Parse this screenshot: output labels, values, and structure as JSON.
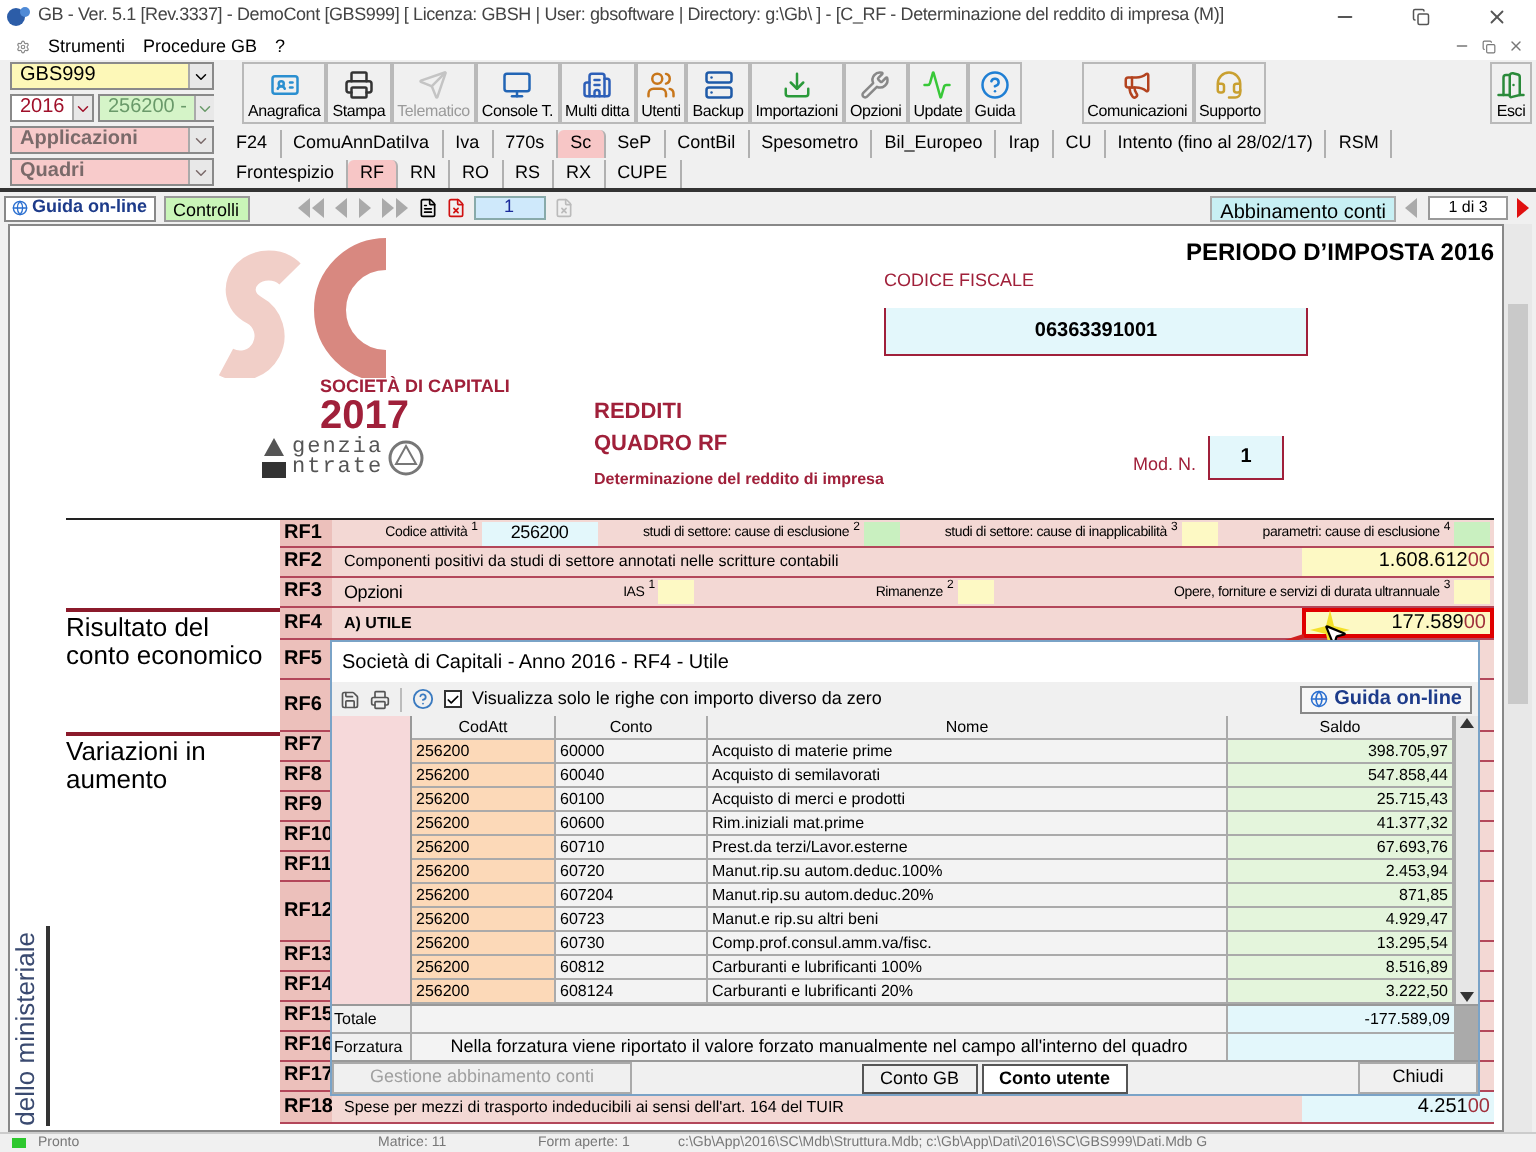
{
  "window": {
    "title": "GB - Ver. 5.1 [Rev.3337] -  DemoCont [GBS999]    [ Licenza: GBSH | User: gbsoftware | Directory: g:\\Gb\\ ] - [C_RF - Determinazione del reddito di impresa (M)]"
  },
  "menu": [
    "Strumenti",
    "Procedure GB",
    "?"
  ],
  "selectors": {
    "company": "GBS999",
    "year": "2016",
    "activity": "256200 -",
    "applications": "Applicazioni",
    "sections": "Quadri"
  },
  "toolbar": {
    "main": [
      {
        "label": "Anagrafica",
        "disabled": false
      },
      {
        "label": "Stampa",
        "disabled": false
      },
      {
        "label": "Telematico",
        "disabled": true
      },
      {
        "label": "Console T.",
        "disabled": false
      },
      {
        "label": "Multi ditta",
        "disabled": false
      },
      {
        "label": "Utenti",
        "disabled": false
      },
      {
        "label": "Backup",
        "disabled": false
      },
      {
        "label": "Importazioni",
        "disabled": false
      },
      {
        "label": "Opzioni",
        "disabled": false
      },
      {
        "label": "Update",
        "disabled": false
      },
      {
        "label": "Guida",
        "disabled": false
      }
    ],
    "support": [
      {
        "label": "Comunicazioni",
        "disabled": false
      },
      {
        "label": "Supporto",
        "disabled": false
      }
    ],
    "exit": {
      "label": "Esci",
      "disabled": false
    }
  },
  "app_tabs": [
    {
      "label": "F24",
      "selected": false
    },
    {
      "label": "ComuAnnDatiIva",
      "selected": false
    },
    {
      "label": "Iva",
      "selected": false
    },
    {
      "label": "770s",
      "selected": false
    },
    {
      "label": "Sc",
      "selected": true
    },
    {
      "label": "SeP",
      "selected": false
    },
    {
      "label": "ContBil",
      "selected": false
    },
    {
      "label": "Spesometro",
      "selected": false
    },
    {
      "label": "Bil_Europeo",
      "selected": false
    },
    {
      "label": "Irap",
      "selected": false
    },
    {
      "label": "CU",
      "selected": false
    },
    {
      "label": "Intento (fino al 28/02/17)",
      "selected": false
    },
    {
      "label": "RSM",
      "selected": false
    }
  ],
  "form_tabs": [
    {
      "label": "Frontespizio",
      "selected": false
    },
    {
      "label": "RF",
      "selected": true
    },
    {
      "label": "RN",
      "selected": false
    },
    {
      "label": "RO",
      "selected": false
    },
    {
      "label": "RS",
      "selected": false
    },
    {
      "label": "RX",
      "selected": false
    },
    {
      "label": "CUPE",
      "selected": false
    }
  ],
  "nav": {
    "help": "Guida on-line",
    "checks": "Controlli",
    "page": "1",
    "links": "Abbinamento conti",
    "page_of": "1 di 3"
  },
  "form": {
    "period": "PERIODO D’IMPOSTA 2016",
    "logo_type": "SOCIETÀ DI CAPITALI",
    "logo_year": "2017",
    "agency": [
      "genzia",
      "ntrate"
    ],
    "title": [
      "REDDITI",
      "QUADRO RF"
    ],
    "subtitle": "Determinazione del reddito di impresa",
    "tax_code_label": "CODICE FISCALE",
    "tax_code": "06363391001",
    "module_label": "Mod. N.",
    "module": "1",
    "side_label": "dello ministeriale"
  },
  "rows": [
    {
      "code": "RF1",
      "kind": "fields",
      "fields": [
        {
          "label": "Codice attività",
          "index": "1",
          "value": "256200",
          "color": "#e3f7fb"
        },
        {
          "label": "studi di settore: cause di esclusione",
          "index": "2",
          "color": "#c9f0c0"
        },
        {
          "label": "studi di settore: cause di inapplicabilità",
          "index": "3",
          "color": "#fdf9c4"
        },
        {
          "label": "parametri: cause di esclusione",
          "index": "4",
          "color": "#c9f0c0"
        }
      ]
    },
    {
      "code": "RF2",
      "kind": "amount",
      "label": "Componenti positivi da studi di settore annotati nelle scritture contabili",
      "value": "1.608.612",
      "cents": "00",
      "color": "#fdf9c4",
      "emphasis": false,
      "highlighted": false
    },
    {
      "code": "RF3",
      "kind": "fields",
      "label": "Opzioni",
      "fields": [
        {
          "label": "IAS",
          "index": "1",
          "color": "#fdf9c4"
        },
        {
          "label": "Rimanenze",
          "index": "2",
          "color": "#fdf9c4"
        },
        {
          "label": "Opere, forniture e servizi di durata ultrannuale",
          "index": "3",
          "color": "#fdf9c4"
        }
      ]
    },
    {
      "code": "RF4",
      "kind": "amount",
      "section": "Risultato del conto economico",
      "label": "A) UTILE",
      "value": "177.589",
      "cents": "00",
      "color": "#fdf9c4",
      "emphasis": true,
      "highlighted": true
    },
    {
      "code": "RF5",
      "kind": "empty"
    },
    {
      "code": "RF6",
      "kind": "empty"
    },
    {
      "code": "RF7",
      "kind": "empty",
      "section": "Variazioni in aumento"
    },
    {
      "code": "RF8",
      "kind": "empty"
    },
    {
      "code": "RF9",
      "kind": "empty"
    },
    {
      "code": "RF10",
      "kind": "empty"
    },
    {
      "code": "RF11",
      "kind": "empty"
    },
    {
      "code": "RF12",
      "kind": "empty"
    },
    {
      "code": "RF13",
      "kind": "empty"
    },
    {
      "code": "RF14",
      "kind": "empty"
    },
    {
      "code": "RF15",
      "kind": "empty"
    },
    {
      "code": "RF16",
      "kind": "empty"
    },
    {
      "code": "RF17",
      "kind": "empty"
    },
    {
      "code": "RF18",
      "kind": "amount",
      "label": "Spese per mezzi di trasporto indeducibili ai sensi dell'art. 164 del TUIR",
      "value": "4.251",
      "cents": "00",
      "color": "#e3f7fb",
      "emphasis": false,
      "highlighted": false
    }
  ],
  "popup": {
    "title": "Società di Capitali - Anno 2016 - RF4 - Utile",
    "filter": {
      "label": "Visualizza solo le righe con importo diverso da zero",
      "checked": true
    },
    "help": "Guida on-line",
    "columns": [
      "CodAtt",
      "Conto",
      "Nome",
      "Saldo"
    ],
    "rows": [
      [
        "256200",
        "60000",
        "Acquisto di materie prime",
        "398.705,97"
      ],
      [
        "256200",
        "60040",
        "Acquisto di semilavorati",
        "547.858,44"
      ],
      [
        "256200",
        "60100",
        "Acquisto di merci e prodotti",
        "25.715,43"
      ],
      [
        "256200",
        "60600",
        "Rim.iniziali mat.prime",
        "41.377,32"
      ],
      [
        "256200",
        "60710",
        "Prest.da terzi/Lavor.esterne",
        "67.693,76"
      ],
      [
        "256200",
        "60720",
        "Manut.rip.su autom.deduc.100%",
        "2.453,94"
      ],
      [
        "256200",
        "607204",
        "Manut.rip.su autom.deduc.20%",
        "871,85"
      ],
      [
        "256200",
        "60723",
        "Manut.e rip.su altri beni",
        "4.929,47"
      ],
      [
        "256200",
        "60730",
        "Comp.prof.consul.amm.va/fisc.",
        "13.295,54"
      ],
      [
        "256200",
        "60812",
        "Carburanti e lubrificanti 100%",
        "8.516,89"
      ],
      [
        "256200",
        "608124",
        "Carburanti e lubrificanti 20%",
        "3.222,50"
      ]
    ],
    "total_label": "Totale",
    "total": "-177.589,09",
    "override_label": "Forzatura",
    "override_note": "Nella forzatura viene riportato il valore forzato manualmente nel campo all'interno del quadro",
    "manage": {
      "label": "Gestione abbinamento conti",
      "disabled": true
    },
    "source_tabs": [
      {
        "label": "Conto GB",
        "selected": false
      },
      {
        "label": "Conto utente",
        "selected": true
      }
    ],
    "close": "Chiudi"
  },
  "status_bar": {
    "status": "Pronto",
    "matrix": "Matrice: 11",
    "forms": "Form aperte: 1",
    "path": "c:\\Gb\\App\\2016\\SC\\Mdb\\Struttura.Mdb; c:\\Gb\\App\\Dati\\2016\\SC\\GBS999\\Dati.Mdb G"
  }
}
